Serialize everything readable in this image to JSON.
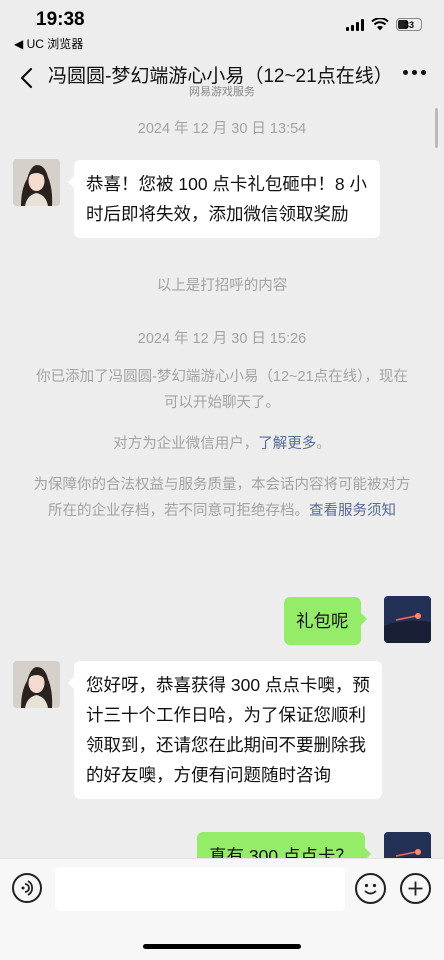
{
  "status_bar": {
    "time": "19:38",
    "back_app": "◀ UC 浏览器",
    "battery": "33"
  },
  "nav": {
    "title": "冯圆圆-梦幻端游心小易（12~21点在线）",
    "subtitle": "网易游戏服务"
  },
  "messages": {
    "ts1": "2024 年 12 月 30 日 13:54",
    "m1": "恭喜！您被 100 点卡礼包砸中！8 小时后即将失效，添加微信领取奖励",
    "greeting_note": "以上是打招呼的内容",
    "ts2": "2024 年 12 月 30 日 15:26",
    "added_note": "你已添加了冯圆圆-梦幻端游心小易（12~21点在线），现在可以开始聊天了。",
    "enterprise_prefix": "对方为企业微信用户，",
    "enterprise_link": "了解更多",
    "enterprise_suffix": "。",
    "archive_note": "为保障你的合法权益与服务质量，本会话内容将可能被对方所在的企业存档，若不同意可拒绝存档。",
    "archive_link": "查看服务须知",
    "m2": "礼包呢",
    "m3": "您好呀，恭喜获得 300 点点卡噢，预计三十个工作日哈，为了保证您顺利领取到，还请您在此期间不要删除我的好友噢，方便有问题随时咨询",
    "m4": "真有 300 点点卡？"
  },
  "colors": {
    "self_bubble": "#95ec69",
    "other_bubble": "#ffffff",
    "link": "#576b95",
    "background": "#ededed"
  },
  "icons": {
    "back": "chevron-left-icon",
    "more": "more-dots-icon",
    "voice": "voice-icon",
    "emoji": "emoji-icon",
    "plus": "plus-icon"
  }
}
